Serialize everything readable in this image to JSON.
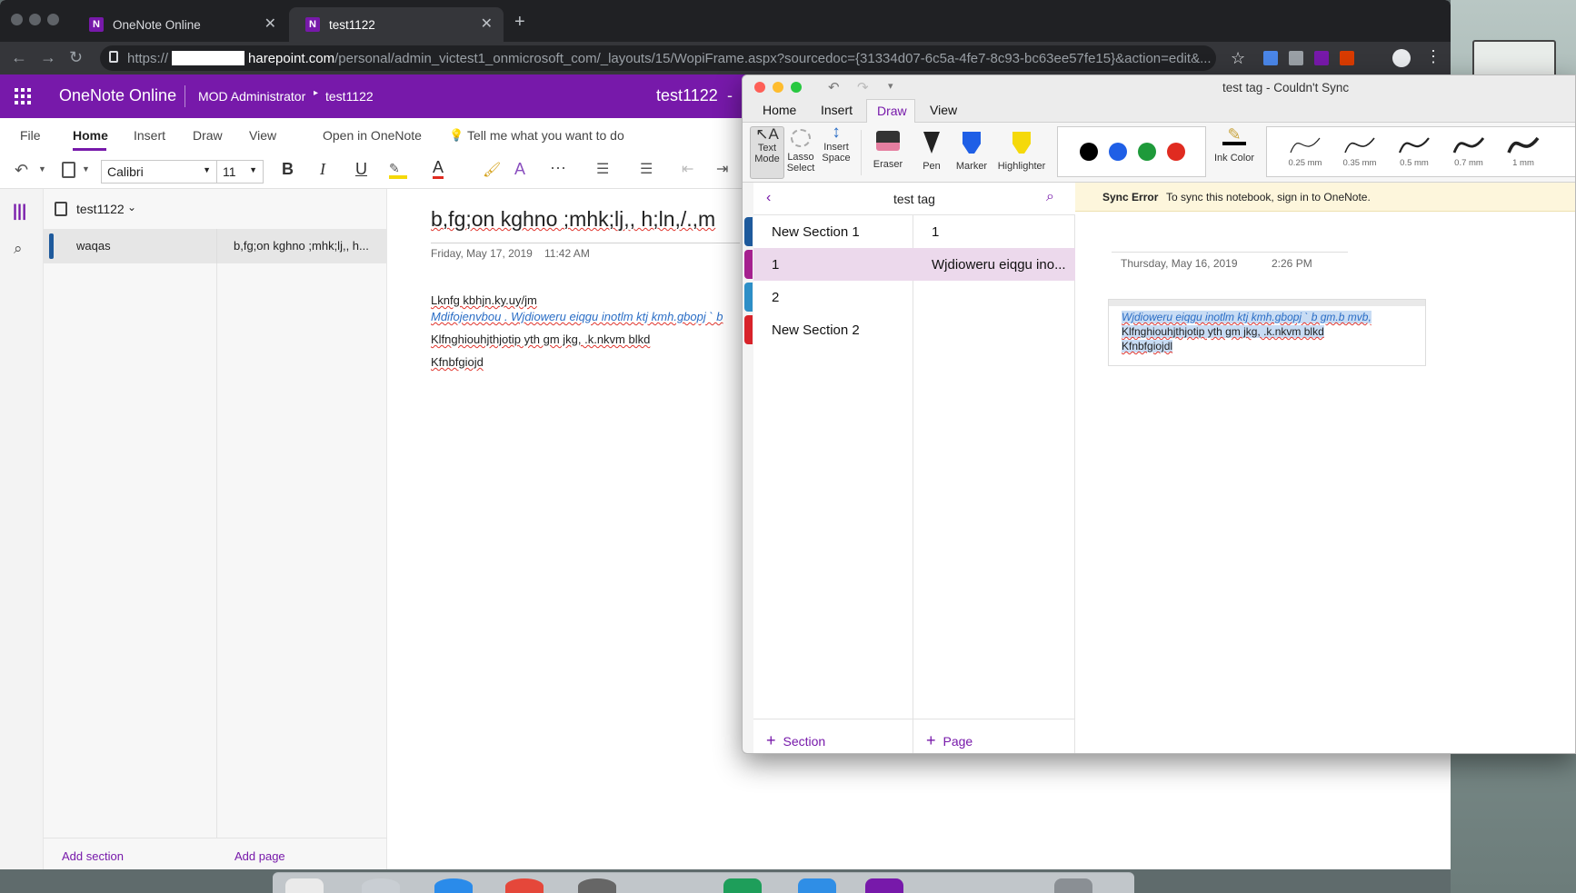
{
  "browser": {
    "tabs": [
      {
        "title": "OneNote Online",
        "icon": "onenote-icon"
      },
      {
        "title": "test1122",
        "icon": "onenote-icon"
      }
    ],
    "url_prefix": "https://",
    "url_host": "harepoint.com",
    "url_path": "/personal/admin_victest1_onmicrosoft_com/_layouts/15/WopiFrame.aspx?sourcedoc={31334d07-6c5a-4fe7-8c93-bc63ee57fe15}&action=edit&..."
  },
  "onenote_online": {
    "app_name": "OneNote Online",
    "user": "MOD Administrator",
    "breadcrumb_notebook": "test1122",
    "header_title": "test1122",
    "ribbon_tabs": [
      "File",
      "Home",
      "Insert",
      "Draw",
      "View"
    ],
    "open_in": "Open in OneNote",
    "tell_me": "Tell me what you want to do",
    "font": "Calibri",
    "font_size": "11",
    "notebook": "test1122",
    "section": "waqas",
    "page_item": "b,fg;on kghno ;mhk;lj,, h...",
    "add_section": "Add section",
    "add_page": "Add page",
    "page": {
      "title": "b,fg;on kghno ;mhk;lj,, h;ln,/.,m",
      "date": "Friday, May 17, 2019",
      "time": "11:42 AM",
      "lines": [
        "Lknfg kbhjn.ky.uy/jm",
        "Mdifojenvbou . Wjdioweru eiqgu inotlm ktj kmh.gbopj ` b",
        "Klfnghiouhjthjotip yth gm jkg, .k.nkvm blkd",
        "Kfnbfgiojd"
      ]
    }
  },
  "mac_onenote": {
    "window_title": "test tag - Couldn't Sync",
    "tabs": [
      "Home",
      "Insert",
      "Draw",
      "View"
    ],
    "active_tab": "Draw",
    "tools": {
      "text_mode": "Text\nMode",
      "lasso": "Lasso\nSelect",
      "insert_space": "Insert\nSpace",
      "eraser": "Eraser",
      "pen": "Pen",
      "marker": "Marker",
      "highlighter": "Highlighter",
      "ink_color": "Ink Color"
    },
    "ink_colors": [
      "#000000",
      "#1f5fe6",
      "#1e9a3a",
      "#e02b20"
    ],
    "thickness": [
      "0.25 mm",
      "0.35 mm",
      "0.5 mm",
      "0.7 mm",
      "1 mm"
    ],
    "notebook_name": "test tag",
    "sections": [
      {
        "name": "New Section 1",
        "color": "#1e5a9c"
      },
      {
        "name": "1",
        "color": "#a5208f"
      },
      {
        "name": "2",
        "color": "#2d8fc7"
      },
      {
        "name": "New Section 2",
        "color": "#d8232a"
      }
    ],
    "pages": [
      "1",
      "Wjdioweru eiqgu ino..."
    ],
    "add_section": "Section",
    "add_page": "Page",
    "sync_error_label": "Sync Error",
    "sync_error_msg": "To sync this notebook, sign in to OneNote.",
    "note_date": "Thursday, May 16, 2019",
    "note_time": "2:26 PM",
    "note_lines": [
      "Wjdioweru eiqgu inotlm ktj kmh.gbopj ` b gm.b mvb,",
      "Klfnghiouhjthjotip yth gm jkg, .k.nkvm blkd",
      "Kfnbfgiojdl"
    ]
  }
}
